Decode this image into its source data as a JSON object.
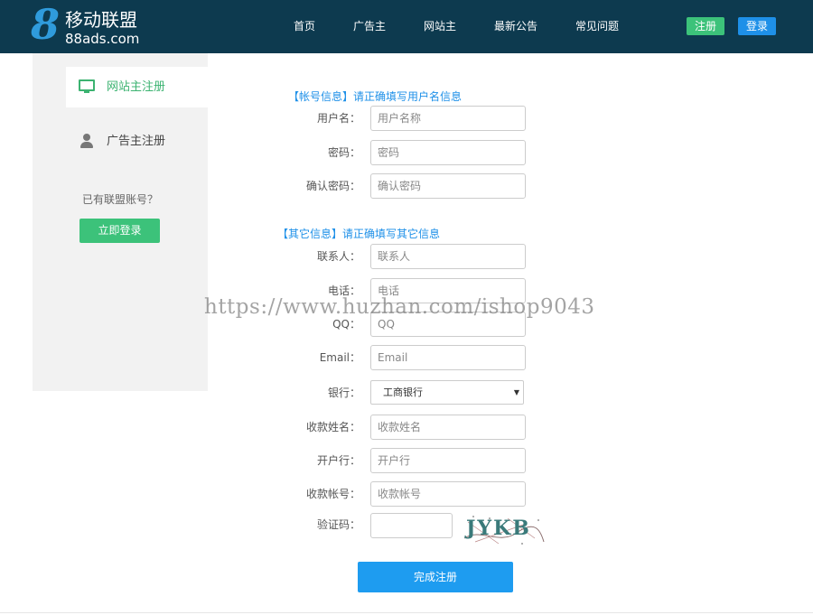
{
  "header": {
    "logo_mark": "8",
    "logo_title": "移动联盟",
    "logo_sub": "88ads.com",
    "nav": [
      "首页",
      "广告主",
      "网站主",
      "最新公告",
      "常见问题"
    ],
    "register_label": "注册",
    "login_label": "登录"
  },
  "sidebar": {
    "items": [
      {
        "label": "网站主注册",
        "icon": "monitor-icon"
      },
      {
        "label": "广告主注册",
        "icon": "user-icon"
      }
    ],
    "hint": "已有联盟账号？",
    "login_button": "立即登录"
  },
  "form": {
    "account_section": "【帐号信息】请正确填写用户名信息",
    "other_section": "【其它信息】请正确填写其它信息",
    "fields": {
      "username": {
        "label": "用户名：",
        "placeholder": "用户名称"
      },
      "password": {
        "label": "密码：",
        "placeholder": "密码"
      },
      "confirm": {
        "label": "确认密码：",
        "placeholder": "确认密码"
      },
      "contact": {
        "label": "联系人：",
        "placeholder": "联系人"
      },
      "phone": {
        "label": "电话：",
        "placeholder": "电话"
      },
      "qq": {
        "label": "QQ：",
        "placeholder": "QQ"
      },
      "email": {
        "label": "Email：",
        "placeholder": "Email"
      },
      "bank": {
        "label": "银行：",
        "value": "工商银行"
      },
      "payee": {
        "label": "收款姓名：",
        "placeholder": "收款姓名"
      },
      "branch": {
        "label": "开户行：",
        "placeholder": "开户行"
      },
      "account": {
        "label": "收款帐号：",
        "placeholder": "收款帐号"
      },
      "captcha": {
        "label": "验证码：",
        "image_text": "JYKB"
      }
    },
    "submit_label": "完成注册"
  },
  "watermark": "https://www.huzhan.com/ishop9043",
  "colors": {
    "header_bg": "#0d3a4f",
    "accent_green": "#3cc27a",
    "accent_blue": "#1e90e8",
    "sidebar_bg": "#f2f2f2"
  }
}
